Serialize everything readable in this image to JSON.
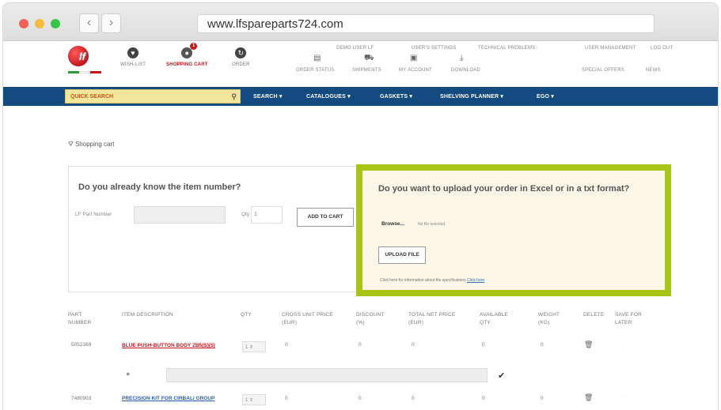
{
  "browser": {
    "url": "www.lfspareparts724.com",
    "back_glyph": "‹",
    "forward_glyph": "›"
  },
  "header": {
    "icons": [
      {
        "label": "WISH-LIST",
        "glyph": "♥"
      },
      {
        "label": "SHOPPING CART",
        "glyph": "🛒",
        "badge": "1"
      },
      {
        "label": "ORDER",
        "glyph": "↻"
      }
    ],
    "account_icons": [
      {
        "label": "ORDER STATUS",
        "glyph": "▤"
      },
      {
        "label": "SHIPMENTS",
        "glyph": "⛟"
      },
      {
        "label": "MY ACCOUNT",
        "glyph": "▣"
      },
      {
        "label": "DOWNLOAD",
        "glyph": "⤓"
      }
    ],
    "user_label": "DEMO USER LF",
    "top_links": [
      "USER'S SETTINGS",
      "TECHNICAL PROBLEMS",
      "USER MANAGEMENT",
      "LOG OUT"
    ],
    "side_links": [
      "SPECIAL OFFERS",
      "NEWS"
    ]
  },
  "nav": {
    "quick_search": "QUICK SEARCH",
    "items": [
      "SEARCH ▾",
      "CATALOGUES ▾",
      "GASKETS ▾",
      "SHELVING PLANNER ▾",
      "EGO ▾"
    ]
  },
  "page": {
    "breadcrumb": "Shopping cart",
    "left_panel": {
      "title": "Do you already know the item number?",
      "part_label": "LF Part Number",
      "qty_label": "Qty",
      "qty_value": "1",
      "add_button": "ADD TO CART"
    },
    "right_panel": {
      "title": "Do you want to upload your order in Excel or in a txt format?",
      "browse": "Browse...",
      "no_file": "No file selected.",
      "upload_button": "UPLOAD FILE",
      "hint": "Click here for information about file specifications",
      "hint_link": "Click here"
    }
  },
  "table": {
    "headers": [
      "PART NUMBER",
      "ITEM DESCRIPTION",
      "QTY",
      "CROSS UNIT PRICE (EUR)",
      "DISCOUNT (%)",
      "TOTAL NET PRICE (EUR)",
      "AVAILABLE QTY",
      "WEIGHT (KG)",
      "DELETE",
      "SAVE FOR LATER"
    ],
    "rows": [
      {
        "part": "5052369",
        "desc": "BLUE PUSH-BUTTON BODY ZB5(S)(5)",
        "qty": "1",
        "price": "0",
        "discount": "0",
        "total": "0",
        "available": "0",
        "weight": "0"
      },
      {
        "part": "7480903",
        "desc": "PRECISION KIT FOR CIRBAL/ GROUP",
        "qty": "1",
        "price": "0",
        "discount": "0",
        "total": "0",
        "available": "0",
        "weight": "0"
      }
    ]
  }
}
